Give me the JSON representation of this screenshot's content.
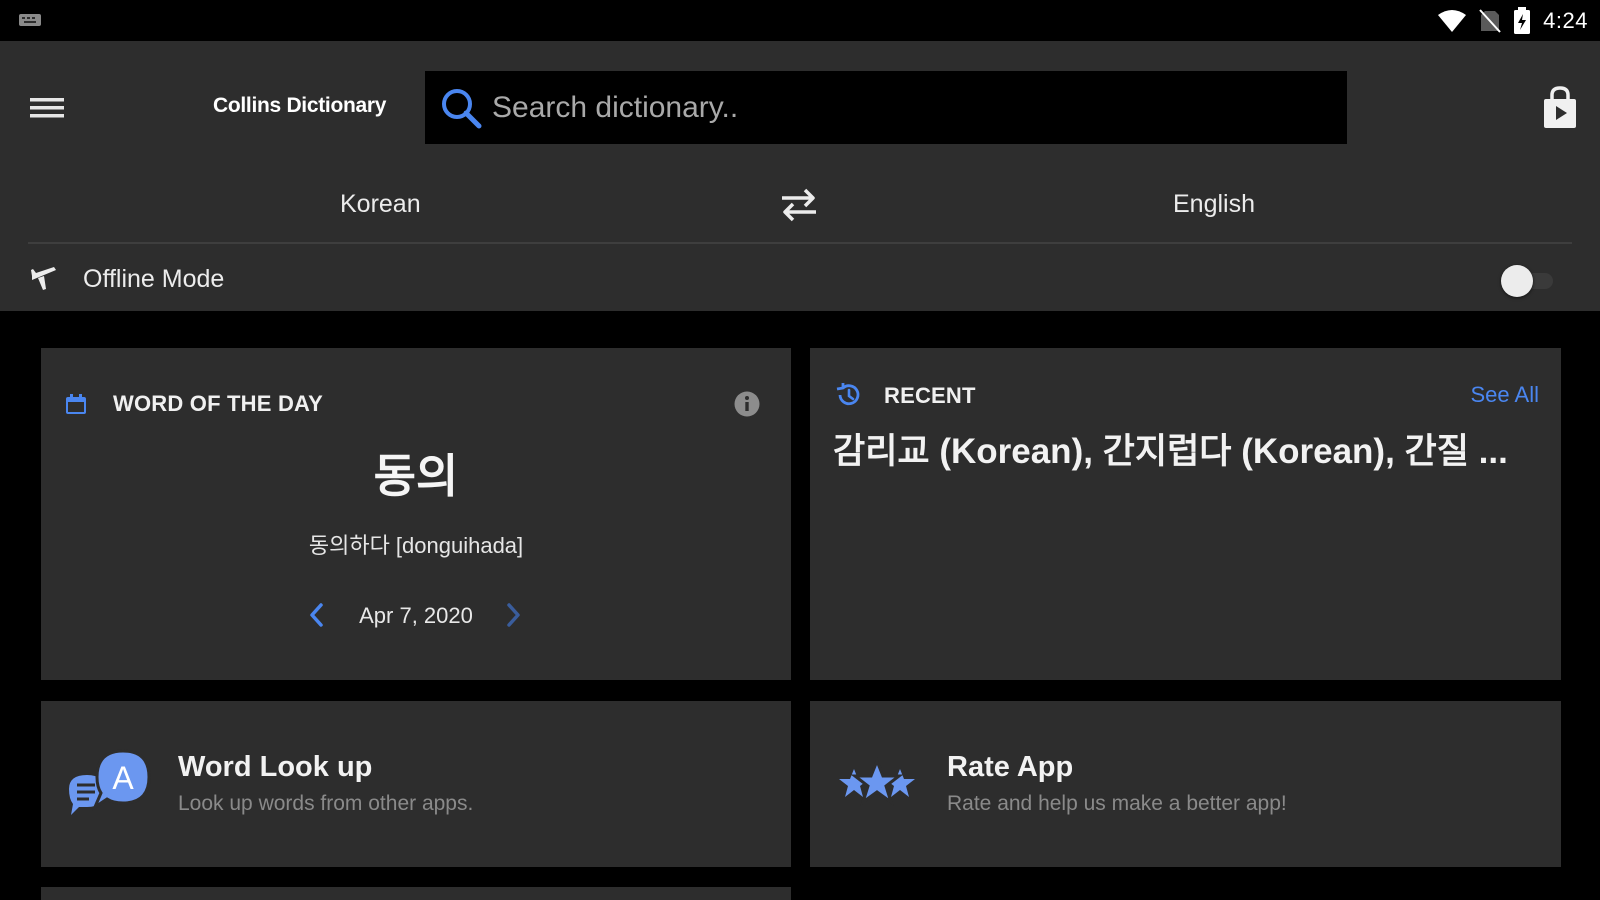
{
  "status_bar": {
    "time": "4:24",
    "icons": [
      "keyboard-icon",
      "wifi-icon",
      "no-sim-icon",
      "battery-charging-icon"
    ]
  },
  "header": {
    "brand": "Collins Dictionary",
    "search_placeholder": "Search dictionary..",
    "source_language": "Korean",
    "target_language": "English",
    "offline_mode_label": "Offline Mode",
    "offline_mode_enabled": false
  },
  "word_of_the_day": {
    "title": "WORD OF THE DAY",
    "word": "동의",
    "pronunciation": "동의하다 [donguihada]",
    "date": "Apr 7, 2020"
  },
  "recent": {
    "title": "RECENT",
    "see_all_label": "See All",
    "items_text": "감리교 (Korean), 간지럽다 (Korean), 간질 ..."
  },
  "promos": {
    "word_lookup": {
      "title": "Word Look up",
      "subtitle": "Look up words from other apps."
    },
    "rate_app": {
      "title": "Rate App",
      "subtitle": "Rate and help us make a better app!"
    }
  },
  "colors": {
    "background": "#000000",
    "surface": "#2d2d2d",
    "accent": "#4a86f0",
    "icon_blue": "#6b97f0",
    "text_primary": "#f2f2f2",
    "text_secondary": "#8a8a8a"
  }
}
